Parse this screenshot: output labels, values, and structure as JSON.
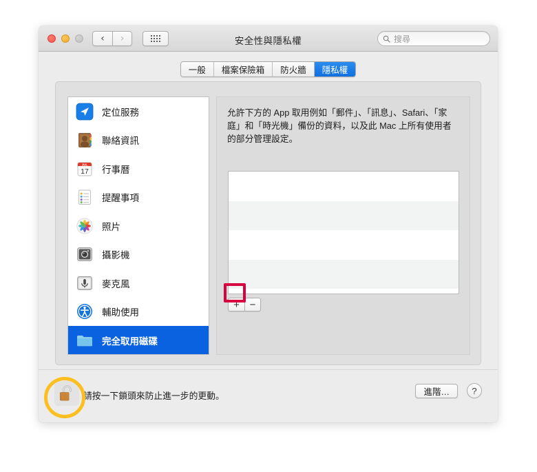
{
  "window": {
    "title": "安全性與隱私權",
    "traffic_lights": [
      "close-button",
      "minimize-button",
      "zoom-button"
    ],
    "nav": {
      "back": "‹",
      "forward": "›",
      "show_all": "show-all-grid-icon"
    }
  },
  "search": {
    "placeholder": "搜尋",
    "icon": "search-icon"
  },
  "tabs": [
    {
      "label": "一般",
      "active": false
    },
    {
      "label": "檔案保險箱",
      "active": false
    },
    {
      "label": "防火牆",
      "active": false
    },
    {
      "label": "隱私權",
      "active": true
    }
  ],
  "sidebar": {
    "items": [
      {
        "label": "定位服務",
        "icon": "location-services-icon",
        "selected": false
      },
      {
        "label": "聯絡資訊",
        "icon": "contacts-icon",
        "selected": false
      },
      {
        "label": "行事曆",
        "icon": "calendar-icon",
        "selected": false
      },
      {
        "label": "提醒事項",
        "icon": "reminders-icon",
        "selected": false
      },
      {
        "label": "照片",
        "icon": "photos-icon",
        "selected": false
      },
      {
        "label": "攝影機",
        "icon": "camera-icon",
        "selected": false
      },
      {
        "label": "麥克風",
        "icon": "microphone-icon",
        "selected": false
      },
      {
        "label": "輔助使用",
        "icon": "accessibility-icon",
        "selected": false
      },
      {
        "label": "完全取用磁碟",
        "icon": "folder-icon",
        "selected": true
      }
    ]
  },
  "calendar_icon": {
    "month": "JUL",
    "day": "17"
  },
  "detail": {
    "description": "允許下方的 App 取用例如「郵件」、「訊息」、Safari、「家庭」和「時光機」備份的資料，以及此 Mac 上所有使用者的部分管理設定。",
    "app_list": {
      "rows": 4,
      "items": []
    },
    "add_label": "+",
    "remove_label": "−"
  },
  "bottom": {
    "lock_icon": "unlocked-padlock-icon",
    "lock_note": "請按一下鎖頭來防止進一步的更動。",
    "advanced_label": "進階…",
    "help_label": "?"
  },
  "annotations": [
    {
      "name": "add-button-highlight",
      "shape": "rect",
      "color": "#d8003f"
    },
    {
      "name": "lock-highlight",
      "shape": "circle",
      "color": "#fcbf21"
    }
  ]
}
